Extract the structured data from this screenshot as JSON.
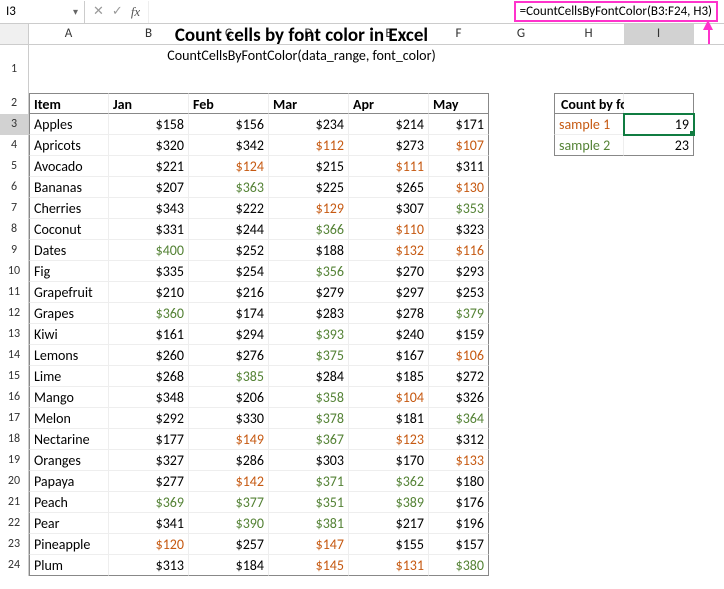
{
  "name_box": "I3",
  "formula_text": "",
  "highlighted_formula": "=CountCellsByFontColor(B3:F24, H3)",
  "columns": [
    "A",
    "B",
    "C",
    "D",
    "E",
    "F",
    "G",
    "H",
    "I"
  ],
  "title1": "Count cells by font color in Excel",
  "title2": "CountCellsByFontColor(data_range, font_color)",
  "header_row": [
    "Item",
    "Jan",
    "Feb",
    "Mar",
    "Apr",
    "May"
  ],
  "count_header": "Count by font color",
  "samples": [
    {
      "label": "sample 1",
      "value": "19",
      "class": "c-orange"
    },
    {
      "label": "sample 2",
      "value": "23",
      "class": "c-green"
    }
  ],
  "rows": [
    {
      "n": 3,
      "item": "Apples",
      "v": [
        {
          "t": "$158"
        },
        {
          "t": "$156"
        },
        {
          "t": "$234"
        },
        {
          "t": "$214"
        },
        {
          "t": "$171"
        }
      ]
    },
    {
      "n": 4,
      "item": "Apricots",
      "v": [
        {
          "t": "$320"
        },
        {
          "t": "$342"
        },
        {
          "t": "$112",
          "c": "c-orange"
        },
        {
          "t": "$273"
        },
        {
          "t": "$107",
          "c": "c-orange"
        }
      ]
    },
    {
      "n": 5,
      "item": "Avocado",
      "v": [
        {
          "t": "$221"
        },
        {
          "t": "$124",
          "c": "c-orange"
        },
        {
          "t": "$215"
        },
        {
          "t": "$111",
          "c": "c-orange"
        },
        {
          "t": "$311"
        }
      ]
    },
    {
      "n": 6,
      "item": "Bananas",
      "v": [
        {
          "t": "$207"
        },
        {
          "t": "$363",
          "c": "c-green"
        },
        {
          "t": "$225"
        },
        {
          "t": "$265"
        },
        {
          "t": "$130",
          "c": "c-orange"
        }
      ]
    },
    {
      "n": 7,
      "item": "Cherries",
      "v": [
        {
          "t": "$343"
        },
        {
          "t": "$222"
        },
        {
          "t": "$129",
          "c": "c-orange"
        },
        {
          "t": "$307"
        },
        {
          "t": "$353",
          "c": "c-green"
        }
      ]
    },
    {
      "n": 8,
      "item": "Coconut",
      "v": [
        {
          "t": "$331"
        },
        {
          "t": "$244"
        },
        {
          "t": "$366",
          "c": "c-green"
        },
        {
          "t": "$110",
          "c": "c-orange"
        },
        {
          "t": "$323"
        }
      ]
    },
    {
      "n": 9,
      "item": "Dates",
      "v": [
        {
          "t": "$400",
          "c": "c-green"
        },
        {
          "t": "$252"
        },
        {
          "t": "$188"
        },
        {
          "t": "$132",
          "c": "c-orange"
        },
        {
          "t": "$116",
          "c": "c-orange"
        }
      ]
    },
    {
      "n": 10,
      "item": "Fig",
      "v": [
        {
          "t": "$335"
        },
        {
          "t": "$254"
        },
        {
          "t": "$356",
          "c": "c-green"
        },
        {
          "t": "$270"
        },
        {
          "t": "$293"
        }
      ]
    },
    {
      "n": 11,
      "item": "Grapefruit",
      "v": [
        {
          "t": "$210"
        },
        {
          "t": "$216"
        },
        {
          "t": "$279"
        },
        {
          "t": "$297"
        },
        {
          "t": "$253"
        }
      ]
    },
    {
      "n": 12,
      "item": "Grapes",
      "v": [
        {
          "t": "$360",
          "c": "c-green"
        },
        {
          "t": "$174"
        },
        {
          "t": "$283"
        },
        {
          "t": "$278"
        },
        {
          "t": "$379",
          "c": "c-green"
        }
      ]
    },
    {
      "n": 13,
      "item": "Kiwi",
      "v": [
        {
          "t": "$161"
        },
        {
          "t": "$294"
        },
        {
          "t": "$393",
          "c": "c-green"
        },
        {
          "t": "$240"
        },
        {
          "t": "$159"
        }
      ]
    },
    {
      "n": 14,
      "item": "Lemons",
      "v": [
        {
          "t": "$260"
        },
        {
          "t": "$276"
        },
        {
          "t": "$375",
          "c": "c-green"
        },
        {
          "t": "$167"
        },
        {
          "t": "$106",
          "c": "c-orange"
        }
      ]
    },
    {
      "n": 15,
      "item": "Lime",
      "v": [
        {
          "t": "$268"
        },
        {
          "t": "$385",
          "c": "c-green"
        },
        {
          "t": "$284"
        },
        {
          "t": "$185"
        },
        {
          "t": "$272"
        }
      ]
    },
    {
      "n": 16,
      "item": "Mango",
      "v": [
        {
          "t": "$348"
        },
        {
          "t": "$206"
        },
        {
          "t": "$358",
          "c": "c-green"
        },
        {
          "t": "$104",
          "c": "c-orange"
        },
        {
          "t": "$326"
        }
      ]
    },
    {
      "n": 17,
      "item": "Melon",
      "v": [
        {
          "t": "$292"
        },
        {
          "t": "$330"
        },
        {
          "t": "$378",
          "c": "c-green"
        },
        {
          "t": "$181"
        },
        {
          "t": "$364",
          "c": "c-green"
        }
      ]
    },
    {
      "n": 18,
      "item": "Nectarine",
      "v": [
        {
          "t": "$177"
        },
        {
          "t": "$149",
          "c": "c-orange"
        },
        {
          "t": "$367",
          "c": "c-green"
        },
        {
          "t": "$123",
          "c": "c-orange"
        },
        {
          "t": "$312"
        }
      ]
    },
    {
      "n": 19,
      "item": "Oranges",
      "v": [
        {
          "t": "$327"
        },
        {
          "t": "$286"
        },
        {
          "t": "$303"
        },
        {
          "t": "$170"
        },
        {
          "t": "$133",
          "c": "c-orange"
        }
      ]
    },
    {
      "n": 20,
      "item": "Papaya",
      "v": [
        {
          "t": "$277"
        },
        {
          "t": "$142",
          "c": "c-orange"
        },
        {
          "t": "$371",
          "c": "c-green"
        },
        {
          "t": "$362",
          "c": "c-green"
        },
        {
          "t": "$180"
        }
      ]
    },
    {
      "n": 21,
      "item": "Peach",
      "v": [
        {
          "t": "$369",
          "c": "c-green"
        },
        {
          "t": "$377",
          "c": "c-green"
        },
        {
          "t": "$351",
          "c": "c-green"
        },
        {
          "t": "$389",
          "c": "c-green"
        },
        {
          "t": "$176"
        }
      ]
    },
    {
      "n": 22,
      "item": "Pear",
      "v": [
        {
          "t": "$341"
        },
        {
          "t": "$390",
          "c": "c-green"
        },
        {
          "t": "$381",
          "c": "c-green"
        },
        {
          "t": "$217"
        },
        {
          "t": "$196"
        }
      ]
    },
    {
      "n": 23,
      "item": "Pineapple",
      "v": [
        {
          "t": "$120",
          "c": "c-orange"
        },
        {
          "t": "$257"
        },
        {
          "t": "$147",
          "c": "c-orange"
        },
        {
          "t": "$155"
        },
        {
          "t": "$157"
        }
      ]
    },
    {
      "n": 24,
      "item": "Plum",
      "v": [
        {
          "t": "$313"
        },
        {
          "t": "$184"
        },
        {
          "t": "$145",
          "c": "c-orange"
        },
        {
          "t": "$131",
          "c": "c-orange"
        },
        {
          "t": "$380",
          "c": "c-green"
        }
      ]
    }
  ]
}
